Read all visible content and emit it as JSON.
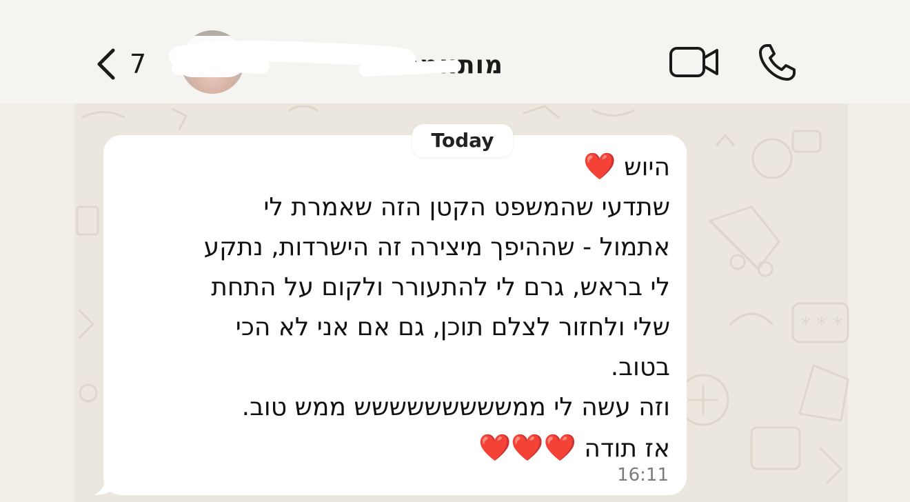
{
  "header": {
    "unread_count": "7",
    "contact_name": "מותאמנות",
    "icons": {
      "back": "chevron-left-icon",
      "video": "video-camera-icon",
      "voice": "phone-icon"
    }
  },
  "chat": {
    "date_chip": "Today",
    "message": {
      "lines": [
        "היוש",
        "שתדעי שהמשפט הקטן הזה שאמרת לי",
        "אתמול - שההיפך מיצירה זה הישרדות, נתקע",
        "לי בראש, גרם לי להתעורר ולקום על התחת",
        "שלי ולחזור לצלם תוכן, גם אם אני לא הכי",
        "בטוב.",
        "וזה עשה לי ממששששששששש ממש טוב.",
        "אז תודה"
      ],
      "emojis": {
        "line1": "❤️",
        "line8": "❤️❤️❤️"
      },
      "time": "16:11"
    }
  },
  "colors": {
    "background": "#f2efe9",
    "bubble": "#ffffff",
    "heart": "#d81e1e",
    "timestamp": "#7b7b7b"
  }
}
